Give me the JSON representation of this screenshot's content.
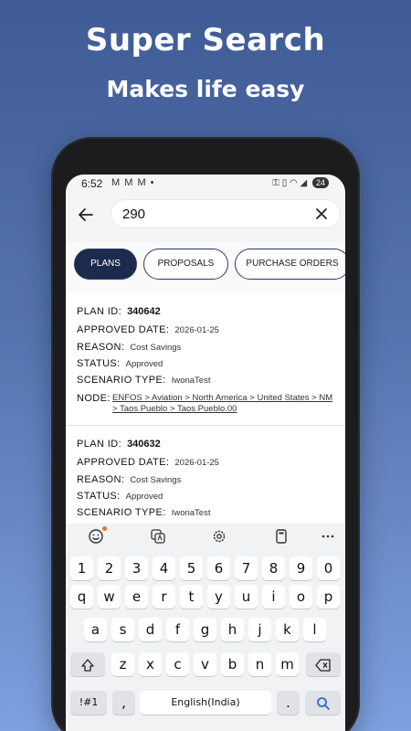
{
  "promo": {
    "headline": "Super Search",
    "subline": "Makes life easy"
  },
  "status_bar": {
    "time": "6:52",
    "notifications": "M M M •",
    "battery": "24"
  },
  "search": {
    "query": "290"
  },
  "tabs": [
    {
      "label": "PLANS",
      "active": true
    },
    {
      "label": "PROPOSALS",
      "active": false
    },
    {
      "label": "PURCHASE ORDERS",
      "active": false
    }
  ],
  "labels": {
    "plan_id": "PLAN ID:",
    "approved_date": "APPROVED DATE:",
    "reason": "REASON:",
    "status": "STATUS:",
    "scenario_type": "SCENARIO TYPE:",
    "node": "NODE:"
  },
  "results": [
    {
      "plan_id": "340642",
      "approved_date": "2026-01-25",
      "reason": "Cost Savings",
      "status": "Approved",
      "scenario_type": "IwonaTest",
      "node": "ENFOS > Aviation > North America > United States > NM > Taos Pueblo > Taos Pueblo.00"
    },
    {
      "plan_id": "340632",
      "approved_date": "2026-01-25",
      "reason": "Cost Savings",
      "status": "Approved",
      "scenario_type": "IwonaTest"
    }
  ],
  "keyboard": {
    "numbers": [
      "1",
      "2",
      "3",
      "4",
      "5",
      "6",
      "7",
      "8",
      "9",
      "0"
    ],
    "row1": [
      "q",
      "w",
      "e",
      "r",
      "t",
      "y",
      "u",
      "i",
      "o",
      "p"
    ],
    "row2": [
      "a",
      "s",
      "d",
      "f",
      "g",
      "h",
      "j",
      "k",
      "l"
    ],
    "row3": [
      "z",
      "x",
      "c",
      "v",
      "b",
      "n",
      "m"
    ],
    "symbols_key": "!#1",
    "comma": ",",
    "space": "English(India)",
    "period": "."
  },
  "colors": {
    "accent": "#1e2a4d",
    "toolbar_dot": "#e8732a",
    "search_key": "#2f6fd6"
  }
}
